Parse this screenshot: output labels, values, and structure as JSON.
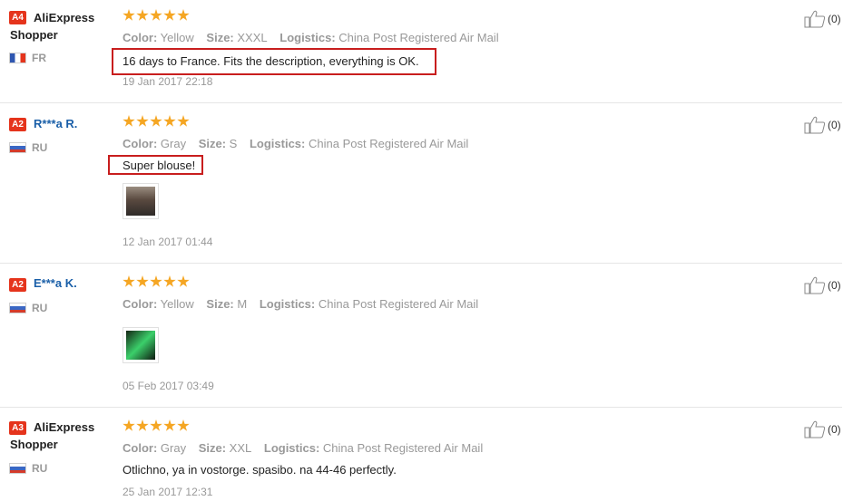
{
  "reviews": [
    {
      "level": "A4",
      "name_line1": "AliExpress",
      "name_line2": "Shopper",
      "country": "FR",
      "color_label": "Color:",
      "color": "Yellow",
      "size_label": "Size:",
      "size": "XXXL",
      "logistics_label": "Logistics:",
      "logistics": "China Post Registered Air Mail",
      "text": "16 days to France. Fits the description, everything is OK.",
      "date": "19 Jan 2017 22:18",
      "likes": "(0)"
    },
    {
      "level": "A2",
      "name": "R***a R.",
      "country": "RU",
      "color_label": "Color:",
      "color": "Gray",
      "size_label": "Size:",
      "size": "S",
      "logistics_label": "Logistics:",
      "logistics": "China Post Registered Air Mail",
      "text": "Super blouse!",
      "date": "12 Jan 2017 01:44",
      "likes": "(0)"
    },
    {
      "level": "A2",
      "name": "E***a K.",
      "country": "RU",
      "color_label": "Color:",
      "color": "Yellow",
      "size_label": "Size:",
      "size": "M",
      "logistics_label": "Logistics:",
      "logistics": "China Post Registered Air Mail",
      "date": "05 Feb 2017 03:49",
      "likes": "(0)"
    },
    {
      "level": "A3",
      "name_line1": "AliExpress",
      "name_line2": "Shopper",
      "country": "RU",
      "color_label": "Color:",
      "color": "Gray",
      "size_label": "Size:",
      "size": "XXL",
      "logistics_label": "Logistics:",
      "logistics": "China Post Registered Air Mail",
      "text": "Otlichno, ya in vostorge. spasibo. na 44-46 perfectly.",
      "date": "25 Jan 2017 12:31",
      "likes": "(0)"
    }
  ],
  "colors": {
    "star": "#f5a623",
    "level_badge": "#e5341c",
    "highlight": "#c81e1e",
    "masked_name": "#1a5fa8"
  },
  "icons": {
    "like": "thumbs-up-icon",
    "rating": "star-icon"
  }
}
